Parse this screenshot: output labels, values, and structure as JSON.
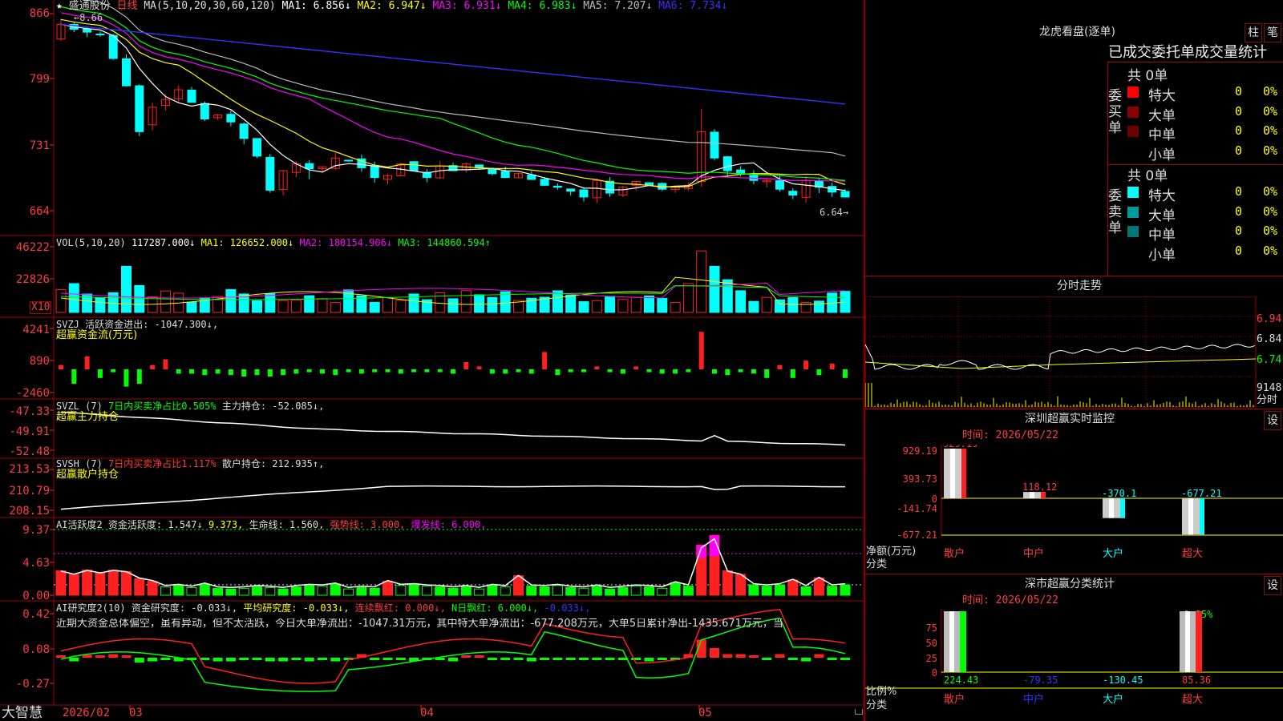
{
  "stock": {
    "star": "★",
    "name": "盛通股份",
    "period": "日线",
    "ma_label": "MA(5,10,20,30,60,120)",
    "ma": [
      {
        "label": "MA1: 6.856↓",
        "color": "#ffffff"
      },
      {
        "label": "MA2: 6.947↓",
        "color": "#ffff00"
      },
      {
        "label": "MA3: 6.931↓",
        "color": "#ff00ff"
      },
      {
        "label": "MA4: 6.983↓",
        "color": "#00ff00"
      },
      {
        "label": "MA5: 7.207↓",
        "color": "#bbbbbb"
      },
      {
        "label": "MA6: 7.734↓",
        "color": "#3333ff"
      }
    ],
    "high_mark": "←8.66",
    "low_mark": "6.64→"
  },
  "price_axis": [
    "866",
    "799",
    "731",
    "664"
  ],
  "vol": {
    "title": "VOL(5,10,20)",
    "value": "117287.000↓",
    "ma1": "MA1: 126652.000↓",
    "ma2": "MA2: 180154.906↓",
    "ma3": "MA3: 144860.594↑",
    "axis": [
      "46222",
      "22826"
    ],
    "unit": "X10"
  },
  "svzj": {
    "title": "SVZJ",
    "label": "活跃资金进出: -1047.300↓,",
    "sub": "超赢资金流(万元)",
    "axis": [
      "4241",
      "890",
      "-2460"
    ]
  },
  "svzl": {
    "title": "SVZL (7)",
    "label1": "7日内买卖净占比0.505%",
    "label2": "主力持仓: -52.085↓,",
    "sub": "超赢主力持仓",
    "axis": [
      "-47.33",
      "-49.91",
      "-52.48"
    ]
  },
  "svsh": {
    "title": "SVSH (7)",
    "label1": "7日内买卖净占比1.117%",
    "label2": "散户持仓: 212.935↑,",
    "sub": "超赢散户持仓",
    "axis": [
      "213.53",
      "210.79",
      "208.15"
    ]
  },
  "ai1": {
    "title": "AI活跃度2",
    "label1": "资金活跃度: 1.547↓",
    "label2": "9.373,",
    "label3": "生命线: 1.560,",
    "label4": "强势线: 3.000,",
    "label5": "爆发线: 6.000,",
    "axis": [
      "9.37",
      "4.63",
      "0.00"
    ]
  },
  "ai2": {
    "title": "AI研究度2(10)",
    "label1": "资金研究度: -0.033↓,",
    "label2": "平均研究度: -0.033↓,",
    "label3": "连续飘红: 0.000↓,",
    "label4": "N日飘红: 6.000↓,",
    "label5": "-0.033↓,",
    "axis": [
      "0.42",
      "0.08",
      "-0.27"
    ],
    "comment": "近期大资金总体偏空，虽有异动，但不太活跃，今日大单净流出：-1047.31万元，其中特大单净流出：-677.208万元，大单5日累计净出-1435.671万元，当"
  },
  "bottom": {
    "logo": "大智慧",
    "dates": [
      "2026/02",
      "03",
      "04",
      "05"
    ]
  },
  "lhkp": {
    "title": "龙虎看盘(逐单)",
    "btn1": "柱",
    "btn2": "笔",
    "tabs": "已成交委托单成交量统计",
    "buy": {
      "label": "委买单",
      "total": "共 0单",
      "rows": [
        {
          "name": "特大",
          "v": "0",
          "p": "0%",
          "color": "#ff0000"
        },
        {
          "name": "大单",
          "v": "0",
          "p": "0%",
          "color": "#8b0000"
        },
        {
          "name": "中单",
          "v": "0",
          "p": "0%",
          "color": "#6b0000"
        },
        {
          "name": "小单",
          "v": "0",
          "p": "0%",
          "color": "#000000"
        }
      ]
    },
    "sell": {
      "label": "委卖单",
      "total": "共 0单",
      "rows": [
        {
          "name": "特大",
          "v": "0",
          "p": "0%",
          "color": "#00ffff"
        },
        {
          "name": "大单",
          "v": "0",
          "p": "0%",
          "color": "#009999"
        },
        {
          "name": "中单",
          "v": "0",
          "p": "0%",
          "color": "#007777"
        },
        {
          "name": "小单",
          "v": "0",
          "p": "0%",
          "color": "#000000"
        }
      ]
    }
  },
  "fenshi": {
    "title": "分时走势",
    "axis": [
      "6.94",
      "6.84",
      "6.74",
      "9148"
    ],
    "unit": "分时"
  },
  "monitor": {
    "title": "深圳超赢实时监控",
    "btn": "设",
    "time": "时间: 2026/05/22",
    "axis": [
      "929.19",
      "393.73",
      "0",
      "-141.74",
      "-677.21"
    ],
    "ylabel": "净额(万元)",
    "xlabel": "分类",
    "cats": [
      {
        "name": "散户",
        "value": 929.19,
        "label": "929.19"
      },
      {
        "name": "中户",
        "value": 118.12,
        "label": "118.12"
      },
      {
        "name": "大户",
        "value": -370.1,
        "label": "-370.1"
      },
      {
        "name": "超大",
        "value": -677.21,
        "label": "-677.21"
      }
    ]
  },
  "classstat": {
    "title": "深市超赢分类统计",
    "btn": "设",
    "time": "时间: 2026/05/22",
    "axis": [
      "75",
      "50",
      "25",
      "0"
    ],
    "ylabel": "比例%",
    "xlabel": "分类",
    "top_label": "-0.25%",
    "cats": [
      {
        "name": "散户",
        "value": "224.43"
      },
      {
        "name": "中户",
        "value": "-79.35"
      },
      {
        "name": "大户",
        "value": "-130.45"
      },
      {
        "name": "超大",
        "value": "85.36"
      }
    ]
  },
  "colors": {
    "up": "#ff2020",
    "down": "#00ffff",
    "grid": "#a00000"
  }
}
